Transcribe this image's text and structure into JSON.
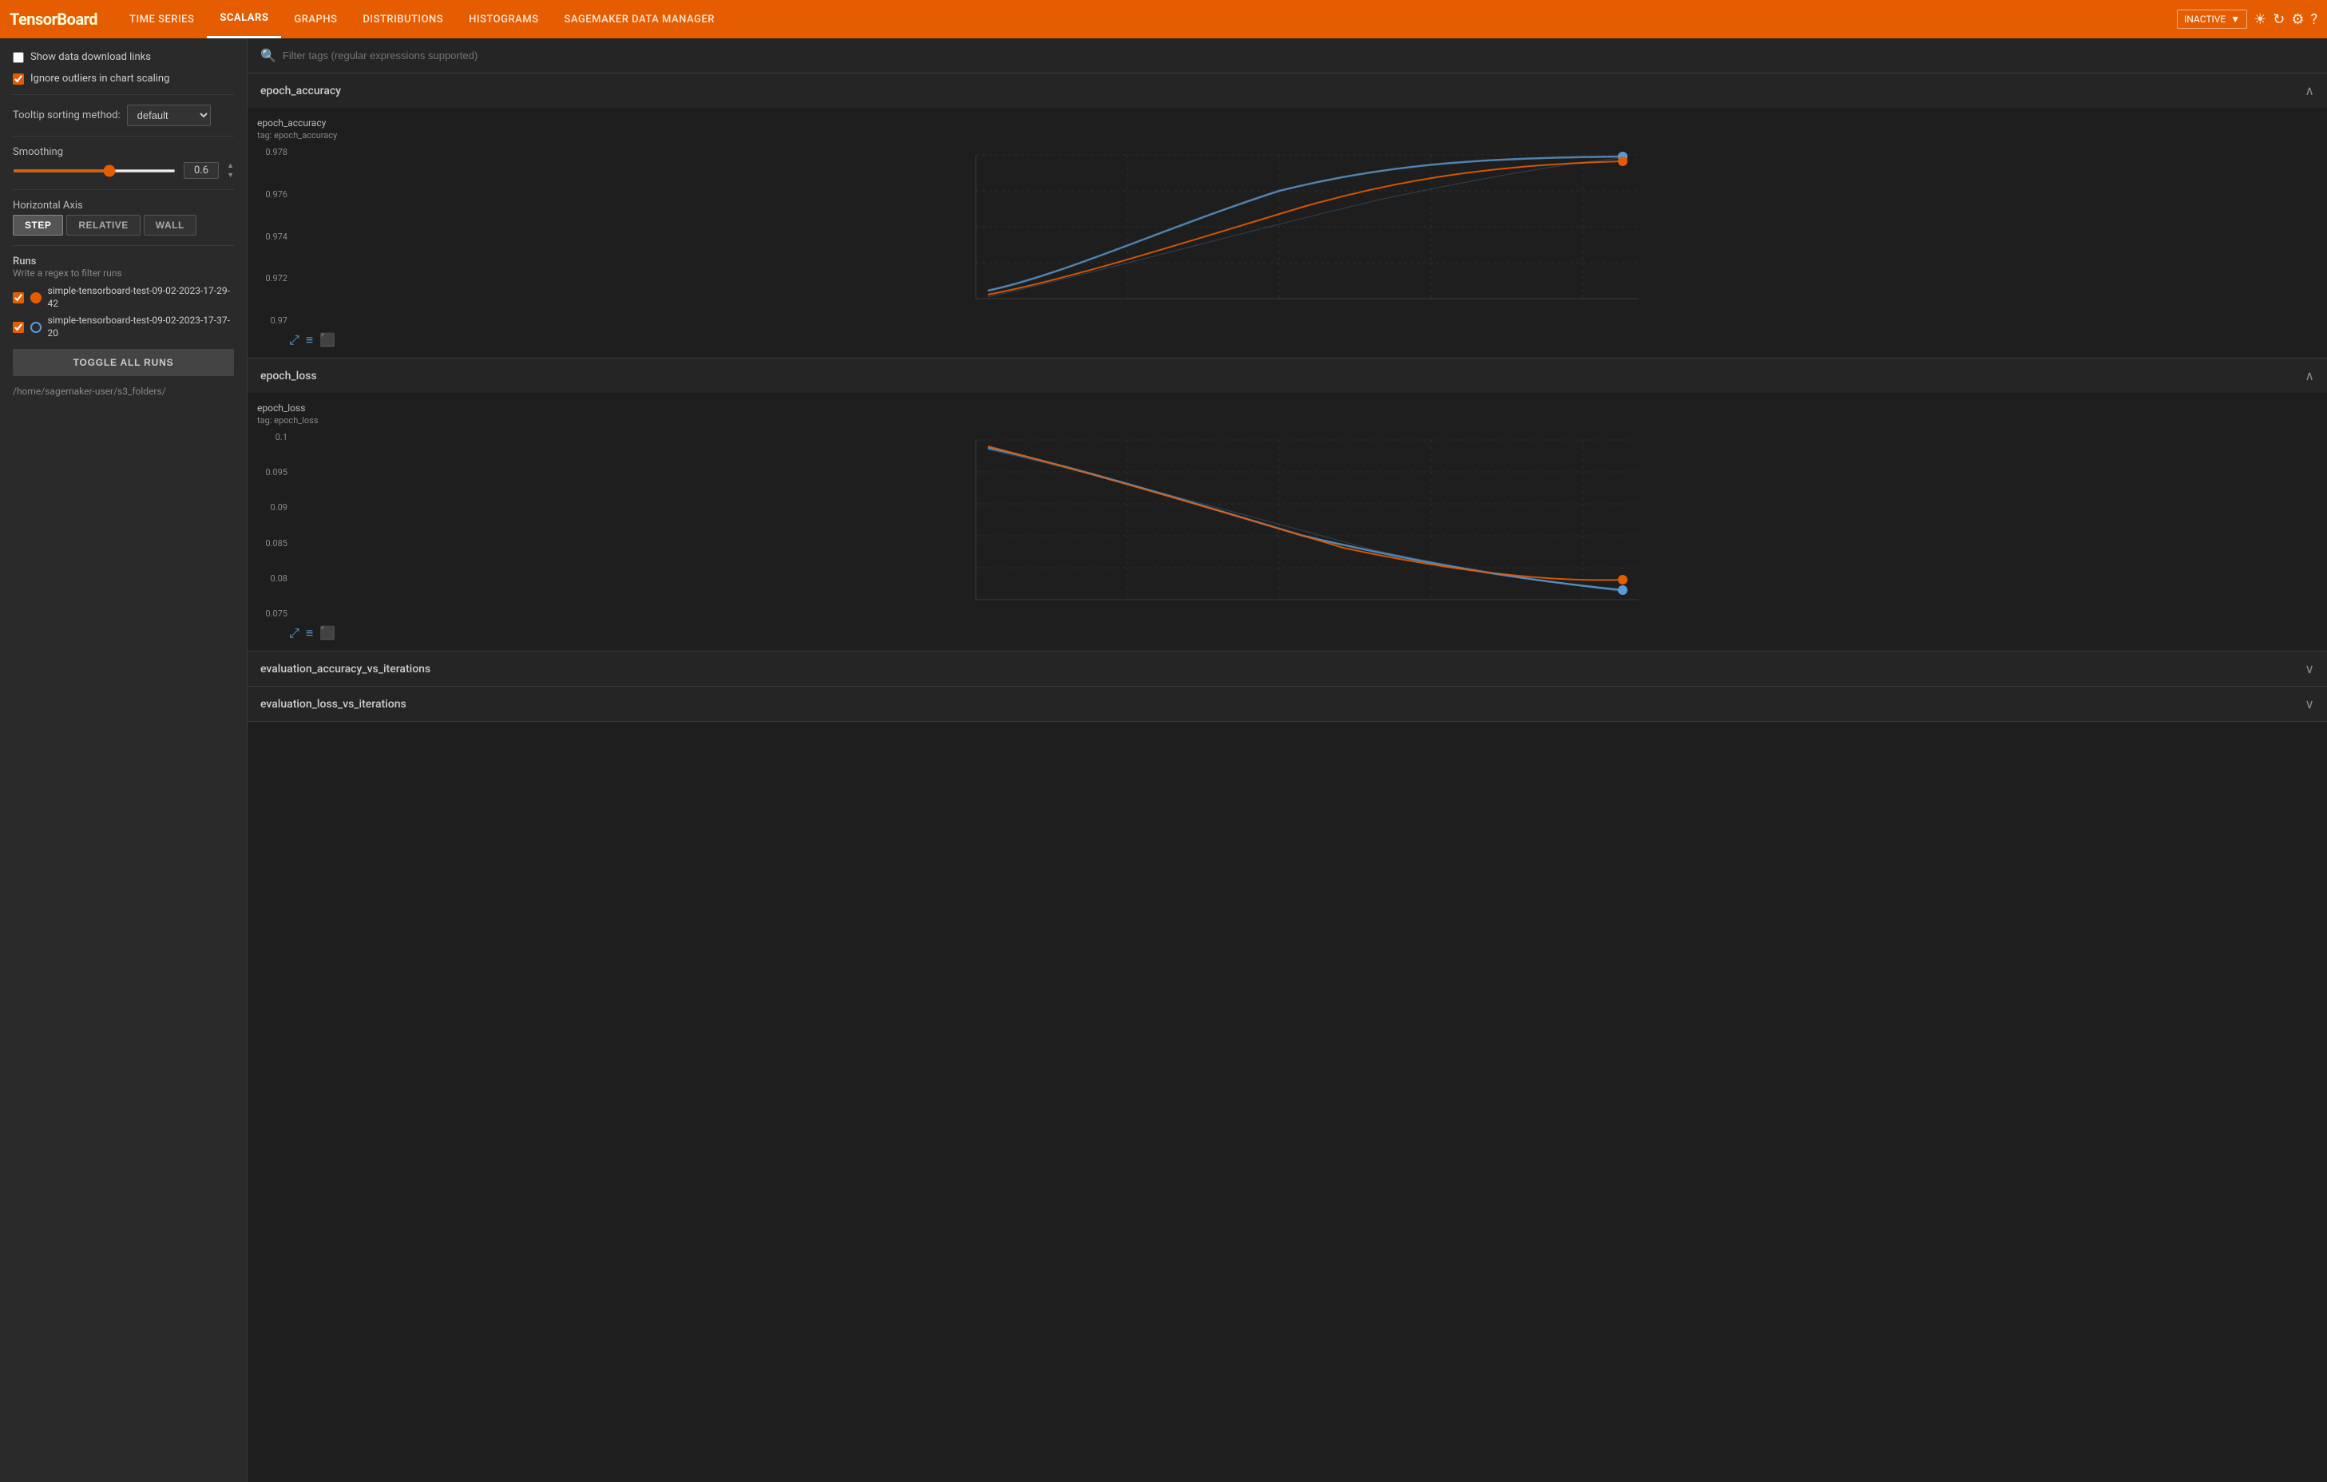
{
  "header": {
    "logo": "TensorBoard",
    "nav_items": [
      {
        "id": "time-series",
        "label": "TIME SERIES",
        "active": false
      },
      {
        "id": "scalars",
        "label": "SCALARS",
        "active": true
      },
      {
        "id": "graphs",
        "label": "GRAPHS",
        "active": false
      },
      {
        "id": "distributions",
        "label": "DISTRIBUTIONS",
        "active": false
      },
      {
        "id": "histograms",
        "label": "HISTOGRAMS",
        "active": false
      },
      {
        "id": "sagemaker",
        "label": "SAGEMAKER DATA MANAGER",
        "active": false
      }
    ],
    "status": "INACTIVE",
    "icons": [
      "brightness",
      "refresh",
      "settings",
      "help"
    ]
  },
  "sidebar": {
    "show_download_links_label": "Show data download links",
    "show_download_links_checked": false,
    "ignore_outliers_label": "Ignore outliers in chart scaling",
    "ignore_outliers_checked": true,
    "tooltip_label": "Tooltip sorting method:",
    "tooltip_value": "default",
    "smoothing_label": "Smoothing",
    "smoothing_value": "0.6",
    "horizontal_axis_label": "Horizontal Axis",
    "axis_buttons": [
      "STEP",
      "RELATIVE",
      "WALL"
    ],
    "active_axis": "STEP",
    "runs_label": "Runs",
    "runs_regex_label": "Write a regex to filter runs",
    "run1": {
      "label": "simple-tensorboard-test-09-02-2023-17-29-42",
      "checked": true,
      "color": "#e65c00"
    },
    "run2": {
      "label": "simple-tensorboard-test-09-02-2023-17-37-20",
      "checked": true,
      "color": "#5b9bd5"
    },
    "toggle_all_label": "TOGGLE ALL RUNS",
    "path": "/home/sagemaker-user/s3_folders/"
  },
  "filter": {
    "placeholder": "Filter tags (regular expressions supported)"
  },
  "charts": [
    {
      "id": "epoch_accuracy",
      "title": "epoch_accuracy",
      "expanded": true,
      "chart_title": "epoch_accuracy",
      "chart_tag": "tag: epoch_accuracy",
      "y_axis": [
        "0.978",
        "0.976",
        "0.974",
        "0.972",
        "0.97"
      ],
      "toolbar_icons": [
        "fullscreen",
        "list",
        "download"
      ]
    },
    {
      "id": "epoch_loss",
      "title": "epoch_loss",
      "expanded": true,
      "chart_title": "epoch_loss",
      "chart_tag": "tag: epoch_loss",
      "y_axis": [
        "0.1",
        "0.095",
        "0.09",
        "0.085",
        "0.08",
        "0.075"
      ],
      "toolbar_icons": [
        "fullscreen",
        "list",
        "download"
      ]
    },
    {
      "id": "evaluation_accuracy_vs_iterations",
      "title": "evaluation_accuracy_vs_iterations",
      "expanded": false
    },
    {
      "id": "evaluation_loss_vs_iterations",
      "title": "evaluation_loss_vs_iterations",
      "expanded": false
    }
  ]
}
